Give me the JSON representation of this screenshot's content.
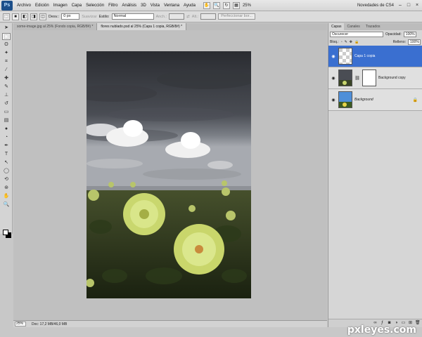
{
  "app": {
    "logo": "Ps"
  },
  "menu": [
    "Archivo",
    "Edición",
    "Imagen",
    "Capa",
    "Selección",
    "Filtro",
    "Análisis",
    "3D",
    "Vista",
    "Ventana",
    "Ayuda"
  ],
  "menubar": {
    "zoom": "25%",
    "workspace": "Novedades de CS4"
  },
  "options": {
    "feather_label": "Desv.:",
    "feather_value": "0 px",
    "antialias": "Suavizar",
    "style_label": "Estilo:",
    "style_value": "Normal",
    "width_label": "Anch.:",
    "height_label": "Alt.:",
    "refine_edge": "Perfeccionar bor..."
  },
  "doc_tabs": [
    "some-image.jpg al 25% (Fondo copia, RGB/8#) *",
    "flores nublado.psd al 25% (Capa 1 copia, RGB/8#) *"
  ],
  "status": {
    "zoom": "25%",
    "doc": "Doc: 17,2 MB/46,0 MB"
  },
  "panel": {
    "tabs": [
      "Capas",
      "Canales",
      "Trazados"
    ],
    "blend_mode": "Oscurecer",
    "opacity_label": "Opacidad:",
    "opacity_value": "100%",
    "lock_label": "Bloq.:",
    "fill_label": "Relleno:",
    "fill_value": "100%",
    "layers": [
      {
        "name": "Capa 1 copia",
        "selected": true
      },
      {
        "name": "Background copy",
        "selected": false
      },
      {
        "name": "Background",
        "selected": false
      }
    ]
  },
  "watermark": "pxleyes.com"
}
